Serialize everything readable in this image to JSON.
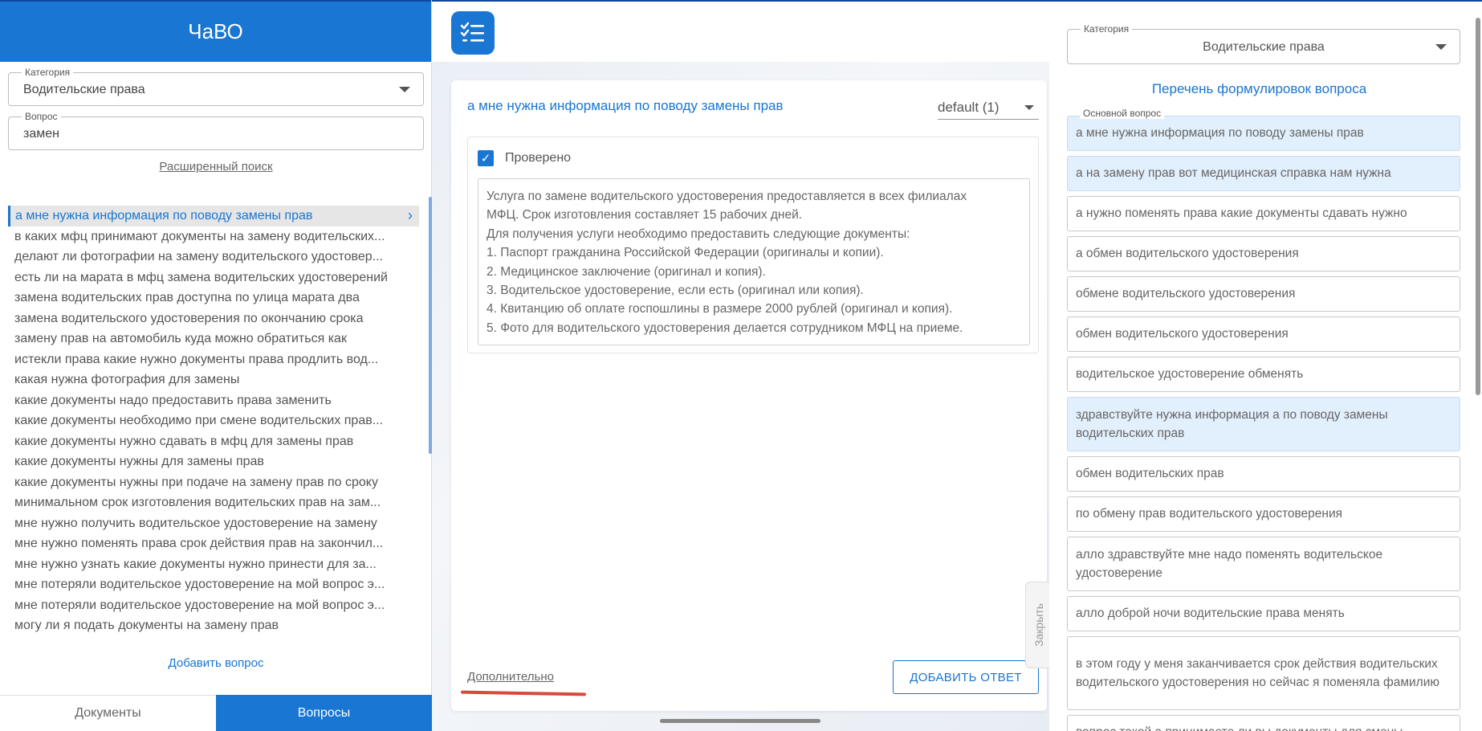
{
  "left": {
    "title": "ЧаВО",
    "category": {
      "label": "Категория",
      "value": "Водительские права"
    },
    "question": {
      "label": "Вопрос",
      "value": "замен"
    },
    "advanced_search": "Расширенный поиск",
    "questions": [
      "а мне нужна информация по поводу замены прав",
      "в каких мфц принимают документы на замену водительских...",
      "делают ли фотографии на замену водительского удостовер...",
      "есть ли на марата в мфц замена водительских удостоверений",
      "замена водительских прав доступна по улица марата два",
      "замена водительского удостоверения по окончанию срока",
      "замену прав на автомобиль куда можно обратиться как",
      "истекли права какие нужно документы права продлить вод...",
      "какая нужна фотография для замены",
      "какие документы надо предоставить права заменить",
      "какие документы необходимо при смене водительских прав...",
      "какие документы нужно сдавать в мфц для замены прав",
      "какие документы нужны для замены прав",
      "какие документы нужны при подаче на замену прав по сроку",
      "минимальном срок изготовления водительских прав на зам...",
      "мне нужно получить водительское удостоверение на замену",
      "мне нужно поменять права срок действия прав на закончил...",
      "мне нужно узнать какие документы нужно принести для за...",
      "мне потеряли водительское удостоверение на мой вопрос э...",
      "мне потеряли водительское удостоверение на мой вопрос э...",
      "могу ли я подать документы на замену прав"
    ],
    "add_question": "Добавить вопрос",
    "tabs": {
      "documents": "Документы",
      "questions": "Вопросы"
    }
  },
  "middle": {
    "card_title": "а мне нужна информация по поводу замены прав",
    "variant": "default (1)",
    "checked_label": "Проверено",
    "answer_lines": [
      "Услуга по замене водительского удостоверения предоставляется в всех филиалах",
      "МФЦ. Срок изготовления составляет 15 рабочих дней.",
      "Для получения услуги необходимо предоставить следующие документы:",
      "1. Паспорт гражданина Российской Федерации (оригиналы и копии).",
      "2. Медицинское заключение (оригинал и копия).",
      "3. Водительское удостоверение, если есть (оригинал или копия).",
      "4. Квитанцию об оплате госпошлины в размере 2000 рублей (оригинал и копия).",
      "5. Фото для водительского удостоверения делается сотрудником МФЦ на приеме."
    ],
    "extra_link": "Дополнительно",
    "add_answer": "ДОБАВИТЬ ОТВЕТ",
    "close_tab": "Закрыть"
  },
  "right": {
    "category": {
      "label": "Категория",
      "value": "Водительские права"
    },
    "heading": "Перечень формулировок вопроса",
    "main_label": "Основной вопрос",
    "phrasings": [
      {
        "text": "а мне нужна информация по поводу замены прав",
        "highlight": true,
        "lines": 1
      },
      {
        "text": "а на замену прав вот медицинская справка нам нужна",
        "highlight": true,
        "lines": 1
      },
      {
        "text": "а нужно поменять права какие документы сдавать нужно",
        "highlight": false,
        "lines": 1
      },
      {
        "text": "а обмен водительского удостоверения",
        "highlight": false,
        "lines": 1
      },
      {
        "text": "обмене водительского удостоверения",
        "highlight": false,
        "lines": 1
      },
      {
        "text": "обмен водительского удостоверения",
        "highlight": false,
        "lines": 1
      },
      {
        "text": "водительское удостоверение обменять",
        "highlight": false,
        "lines": 1
      },
      {
        "text": "здравствуйте нужна информация а по поводу замены водительских прав",
        "highlight": true,
        "lines": 2
      },
      {
        "text": "обмен водительских прав",
        "highlight": false,
        "lines": 1
      },
      {
        "text": "по обмену прав водительского удостоверения",
        "highlight": false,
        "lines": 1
      },
      {
        "text": "алло здравствуйте мне надо поменять водительское удостоверение",
        "highlight": false,
        "lines": 2
      },
      {
        "text": "алло доброй ночи водительские права менять",
        "highlight": false,
        "lines": 1
      },
      {
        "text": "в этом году у меня заканчивается срок действия водительских водительского удостоверения но сейчас я поменяла фамилию",
        "highlight": false,
        "lines": 3
      },
      {
        "text": "вопрос такой а принимаете ли вы документы для смены",
        "highlight": false,
        "lines": 1
      }
    ]
  }
}
